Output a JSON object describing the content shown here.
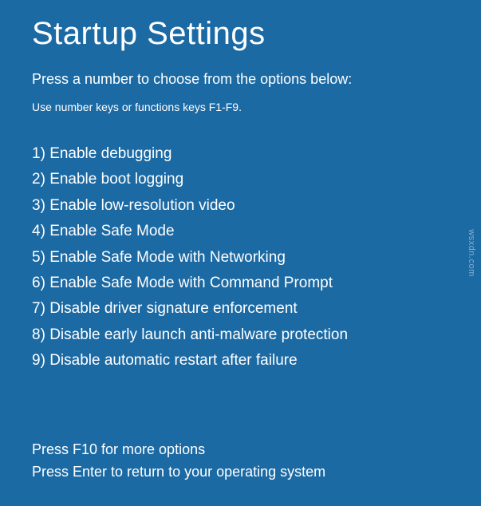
{
  "title": "Startup Settings",
  "subtitle": "Press a number to choose from the options below:",
  "hint": "Use number keys or functions keys F1-F9.",
  "options": [
    {
      "num": "1",
      "label": "Enable debugging"
    },
    {
      "num": "2",
      "label": "Enable boot logging"
    },
    {
      "num": "3",
      "label": "Enable low-resolution video"
    },
    {
      "num": "4",
      "label": "Enable Safe Mode"
    },
    {
      "num": "5",
      "label": "Enable Safe Mode with Networking"
    },
    {
      "num": "6",
      "label": "Enable Safe Mode with Command Prompt"
    },
    {
      "num": "7",
      "label": "Disable driver signature enforcement"
    },
    {
      "num": "8",
      "label": "Disable early launch anti-malware protection"
    },
    {
      "num": "9",
      "label": "Disable automatic restart after failure"
    }
  ],
  "footer": {
    "more": "Press F10 for more options",
    "return": "Press Enter to return to your operating system"
  },
  "watermark": "wsxdn.com"
}
